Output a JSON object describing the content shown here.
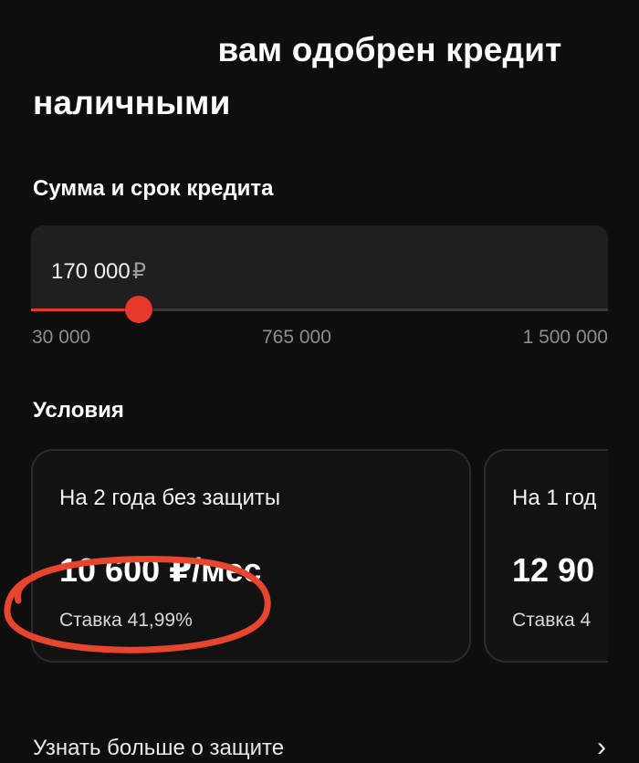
{
  "offer": {
    "title": "вам одобрен кредит наличными"
  },
  "loan": {
    "section_label": "Сумма и срок кредита",
    "amount": "170 000",
    "currency": "₽",
    "slider": {
      "min_label": "30 000",
      "mid_label": "765 000",
      "max_label": "1 500 000",
      "min": 30000,
      "max": 1500000,
      "value": 170000
    }
  },
  "conditions": {
    "section_label": "Условия",
    "cards": [
      {
        "title": "На 2 года без защиты",
        "payment": "10 600 ₽/мес",
        "rate": "Ставка 41,99%"
      },
      {
        "title": "На 1 год",
        "payment": "12 90",
        "rate": "Ставка 4"
      }
    ]
  },
  "footer": {
    "link_text": "Узнать больше о защите"
  },
  "colors": {
    "accent": "#e8382c",
    "annotation": "#e8452e",
    "background": "#0e0e0f",
    "field": "#1f1f21"
  },
  "icons": {
    "chevron": "chevron-right-icon"
  }
}
